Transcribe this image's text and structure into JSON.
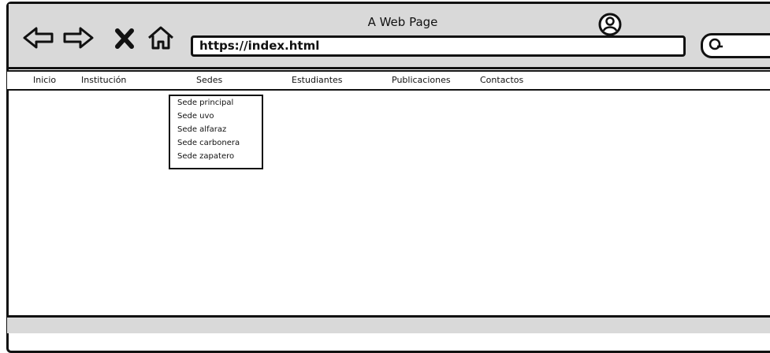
{
  "browser": {
    "page_title": "A Web Page",
    "url": "https://index.html",
    "icons": [
      "back-arrow",
      "forward-arrow",
      "close",
      "home",
      "account",
      "search"
    ]
  },
  "menu": {
    "items": [
      "Inicio",
      "Institución",
      "Sedes",
      "Estudiantes",
      "Publicaciones",
      "Contactos"
    ]
  },
  "dropdown": {
    "items": [
      "Sede principal",
      "Sede uvo",
      "Sede alfaraz",
      "Sede carbonera",
      "Sede zapatero"
    ]
  }
}
